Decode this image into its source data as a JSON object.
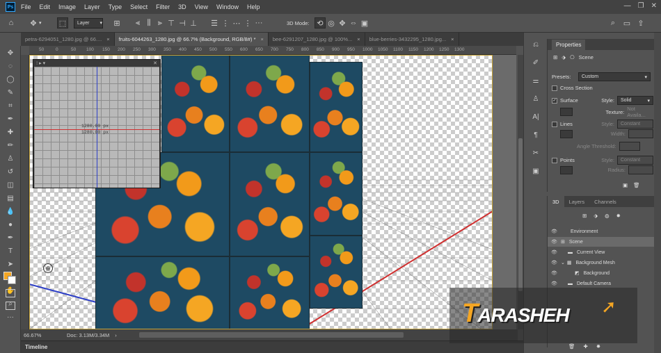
{
  "menubar": {
    "app_icon": "Ps",
    "items": [
      "File",
      "Edit",
      "Image",
      "Layer",
      "Type",
      "Select",
      "Filter",
      "3D",
      "View",
      "Window",
      "Help"
    ]
  },
  "options": {
    "layer_select": "Layer",
    "mode_label": "3D Mode:"
  },
  "tabs": [
    {
      "label": "petra-6294051_1280.jpg @ 66....",
      "active": false
    },
    {
      "label": "fruits-6044263_1280.jpg @ 66.7% (Background, RGB/8#) *",
      "active": true
    },
    {
      "label": "bee-6291207_1280.jpg @ 100%...",
      "active": false
    },
    {
      "label": "blue-berries-3432295_1280.jpg...",
      "active": false
    }
  ],
  "ruler": {
    "marks": [
      "50",
      "0",
      "50",
      "100",
      "150",
      "200",
      "250",
      "300",
      "350",
      "400",
      "450",
      "500",
      "550",
      "600",
      "650",
      "700",
      "750",
      "800",
      "850",
      "900",
      "950",
      "1000",
      "1050",
      "1100",
      "1150",
      "1200",
      "1250",
      "1300"
    ]
  },
  "camera_view": {
    "dim_1": "1280.00 px",
    "dim_2": "1280.00 px"
  },
  "status": {
    "zoom": "66.67%",
    "doc": "Doc: 3.13M/3.34M"
  },
  "timeline": {
    "label": "Timeline"
  },
  "properties": {
    "title": "Properties",
    "scene_label": "Scene",
    "presets_label": "Presets:",
    "presets_value": "Custom",
    "cross_section": "Cross Section",
    "surface": "Surface",
    "style_label": "Style:",
    "surface_style": "Solid",
    "texture_label": "Texture:",
    "texture_value": "Not Availa...",
    "lines": "Lines",
    "lines_style": "Constant",
    "width_label": "Width:",
    "angle_threshold": "Angle Threshold:",
    "points": "Points",
    "points_style": "Constant",
    "radius_label": "Radius:"
  },
  "panel3d": {
    "tabs": [
      "3D",
      "Layers",
      "Channels"
    ],
    "items": [
      {
        "label": "Environment",
        "selected": false
      },
      {
        "label": "Scene",
        "selected": true
      },
      {
        "label": "Current View",
        "selected": false
      },
      {
        "label": "Background Mesh",
        "selected": false
      },
      {
        "label": "Background",
        "selected": false
      },
      {
        "label": "Default Camera",
        "selected": false
      }
    ]
  },
  "logo": {
    "first": "T",
    "rest": "ARASHEH"
  },
  "colors": {
    "accent": "#31a8ff",
    "foreground": "#f5a623",
    "background": "#ffffff",
    "x_axis": "#d03030",
    "z_axis": "#2d3fc7"
  }
}
